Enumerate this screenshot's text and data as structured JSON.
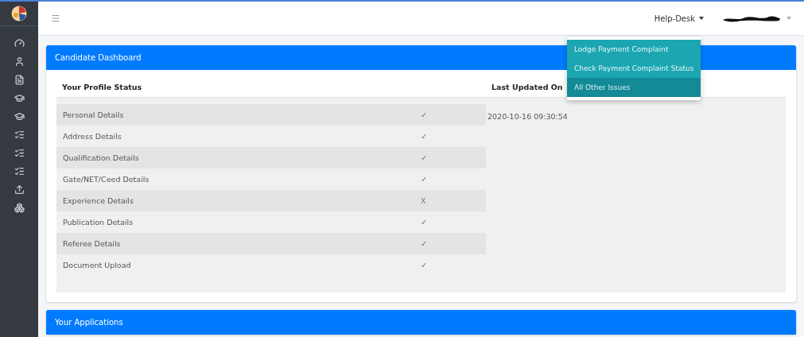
{
  "header": {
    "helpdesk_label": "Help-Desk",
    "helpdesk_expanded": true
  },
  "helpdesk_menu": [
    {
      "label": "Lodge Payment Complaint",
      "selected": false
    },
    {
      "label": "Check Payment Complaint Status",
      "selected": false
    },
    {
      "label": "All Other Issues",
      "selected": true
    }
  ],
  "dashboard_card": {
    "title": "Candidate Dashboard",
    "profile_heading": "Your Profile Status",
    "updated_heading": "Last Updated On",
    "updated_value": "2020-10-16 09:30:54",
    "rows": [
      {
        "label": "Personal Details",
        "mark": "✓"
      },
      {
        "label": "Address Details",
        "mark": "✓"
      },
      {
        "label": "Qualification Details",
        "mark": "✓"
      },
      {
        "label": "Gate/NET/Ceed Details",
        "mark": "✓"
      },
      {
        "label": "Experience Details",
        "mark": "X"
      },
      {
        "label": "Publication Details",
        "mark": "✓"
      },
      {
        "label": "Referee Details",
        "mark": "✓"
      },
      {
        "label": "Document Upload",
        "mark": "✓"
      }
    ]
  },
  "applications_card": {
    "title": "Your Applications"
  }
}
